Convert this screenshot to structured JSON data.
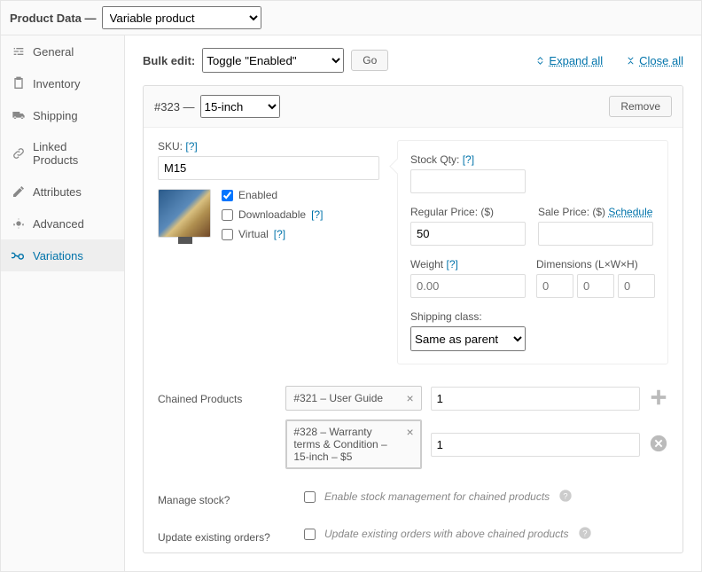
{
  "header": {
    "title": "Product Data —",
    "product_type": "Variable product"
  },
  "sidebar": {
    "items": [
      {
        "label": "General"
      },
      {
        "label": "Inventory"
      },
      {
        "label": "Shipping"
      },
      {
        "label": "Linked Products"
      },
      {
        "label": "Attributes"
      },
      {
        "label": "Advanced"
      },
      {
        "label": "Variations"
      }
    ]
  },
  "bulk": {
    "label": "Bulk edit:",
    "action": "Toggle \"Enabled\"",
    "go": "Go",
    "expand": "Expand all",
    "close": "Close all"
  },
  "variation": {
    "id": "#323 —",
    "size": "15-inch",
    "remove": "Remove",
    "sku_label": "SKU:",
    "sku_value": "M15",
    "enabled": "Enabled",
    "downloadable": "Downloadable",
    "virtual": "Virtual",
    "stock_label": "Stock Qty:",
    "stock_value": "",
    "reg_label": "Regular Price: ($)",
    "reg_value": "50",
    "sale_label": "Sale Price: ($)",
    "sale_value": "",
    "schedule": "Schedule",
    "weight_label": "Weight",
    "weight_value": "0.00",
    "dim_label": "Dimensions (L×W×H)",
    "dim_l": "0",
    "dim_w": "0",
    "dim_h": "0",
    "ship_label": "Shipping class:",
    "ship_value": "Same as parent"
  },
  "chained": {
    "label": "Chained Products",
    "items": [
      {
        "text": "#321 – User Guide",
        "qty": "1"
      },
      {
        "text": "#328 – Warranty terms & Condition – 15-inch – $5",
        "qty": "1"
      }
    ]
  },
  "manage": {
    "label": "Manage stock?",
    "desc": "Enable stock management for chained products"
  },
  "update": {
    "label": "Update existing orders?",
    "desc": "Update existing orders with above chained products"
  },
  "help": "[?]"
}
